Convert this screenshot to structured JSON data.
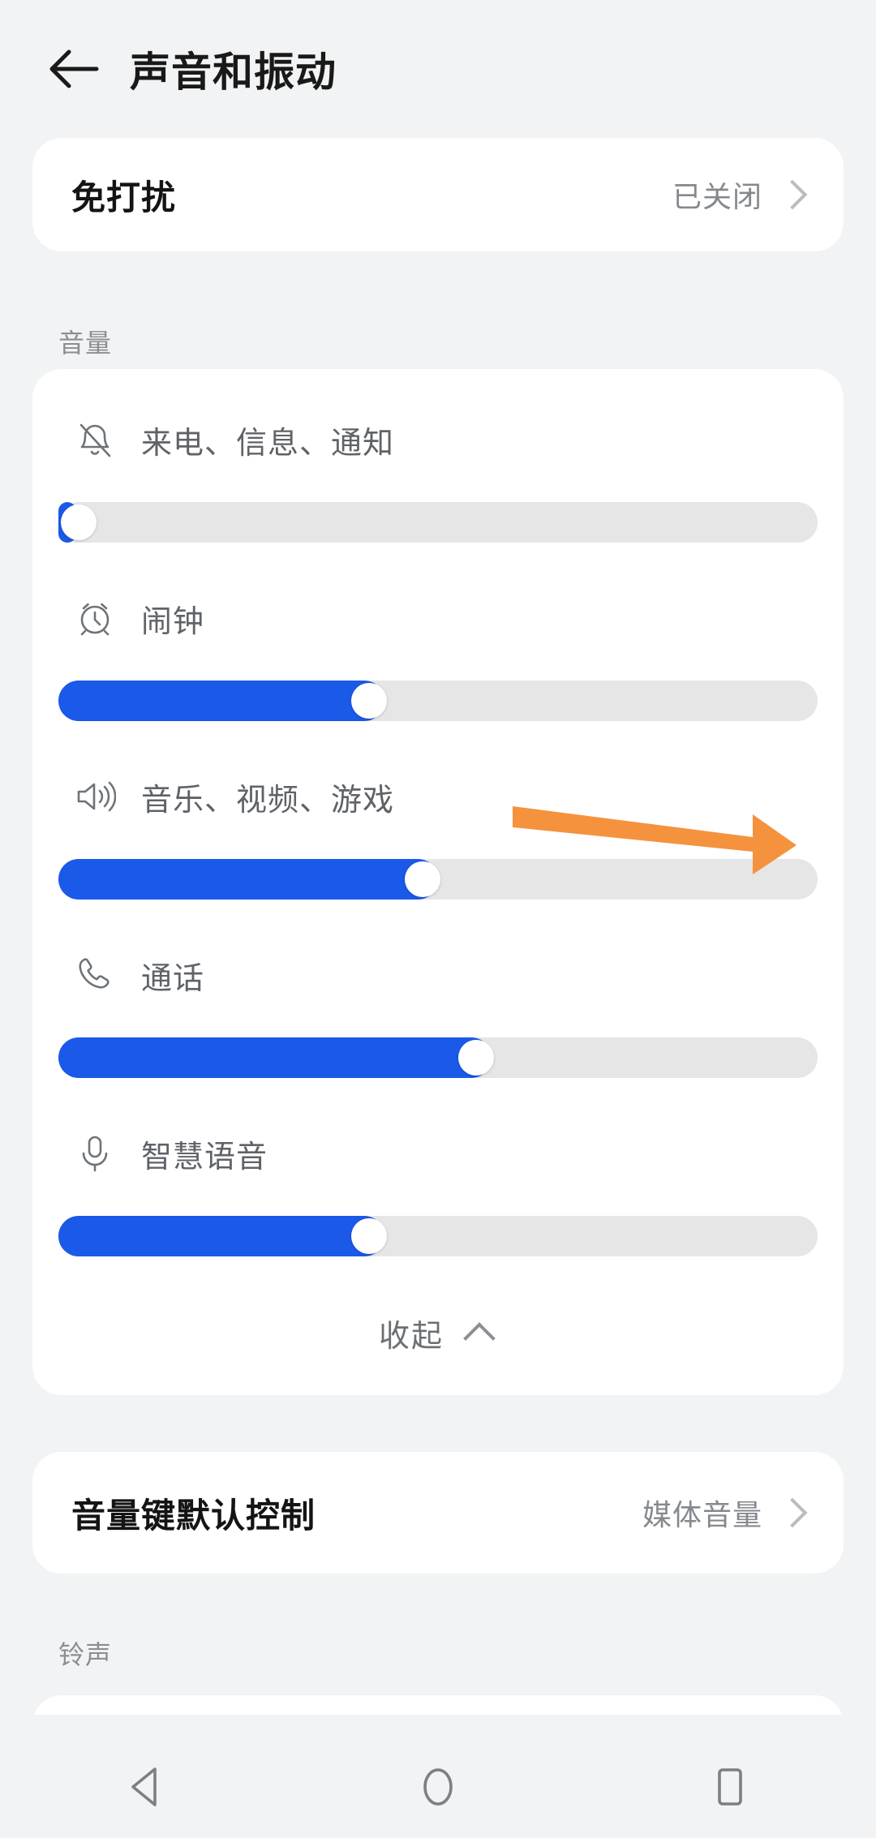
{
  "theme": {
    "background": "#F1F3F4",
    "card_background": "#FFFFFF",
    "accent_blue": "#1B59E8",
    "track_gray": "#E6E6E6",
    "annotation_orange": "#F5923E",
    "title_color": "#141414",
    "secondary_text": "#85898E"
  },
  "header": {
    "back_icon": "arrow-left-icon",
    "title": "声音和振动"
  },
  "dnd_card": {
    "title": "免打扰",
    "value": "已关闭",
    "chevron_icon": "chevron-right-icon"
  },
  "volume_section": {
    "label": "音量",
    "rows": [
      {
        "icon": "bell-off-icon",
        "label": "来电、信息、通知",
        "value_percent": 0
      },
      {
        "icon": "alarm-clock-icon",
        "label": "闹钟",
        "value_percent": 43
      },
      {
        "icon": "speaker-wave-icon",
        "label": "音乐、视频、游戏",
        "value_percent": 50
      },
      {
        "icon": "phone-icon",
        "label": "通话",
        "value_percent": 57
      },
      {
        "icon": "microphone-icon",
        "label": "智慧语音",
        "value_percent": 43
      }
    ],
    "collapse": {
      "label": "收起",
      "icon": "chevron-up-icon"
    }
  },
  "volume_key_card": {
    "title": "音量键默认控制",
    "value": "媒体音量",
    "chevron_icon": "chevron-right-icon"
  },
  "ringtone_section": {
    "label": "铃声"
  },
  "annotation": {
    "type": "arrow",
    "color": "#F5923E",
    "points_to": "音乐、视频、游戏"
  },
  "navbar": {
    "back": "nav-back-icon",
    "home": "nav-home-icon",
    "recents": "nav-recents-icon"
  }
}
